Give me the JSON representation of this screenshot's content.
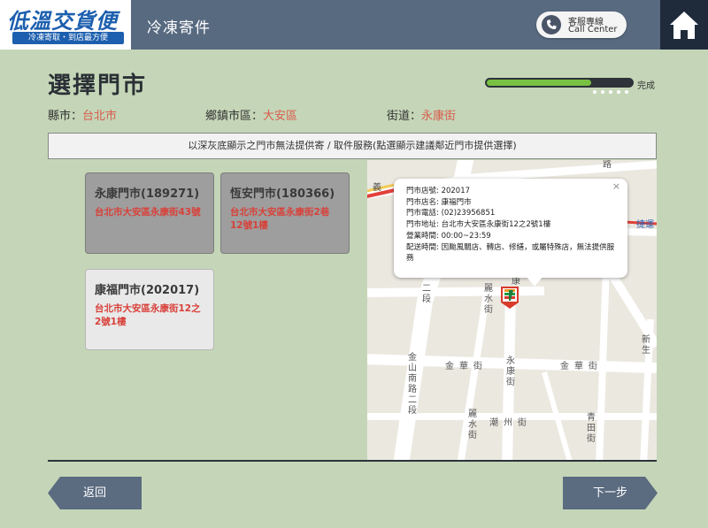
{
  "header": {
    "logo_text": "低溫交貨便",
    "logo_sub": "冷凍寄取・到店最方便",
    "title": "冷凍寄件",
    "call_center_line1": "客服專線",
    "call_center_line2": "Call Center",
    "phone_icon": "phone-icon",
    "home_icon": "home-icon"
  },
  "page": {
    "title": "選擇門市",
    "progress_label": "完成",
    "progress_fraction": 0.72
  },
  "filters": {
    "city_label": "縣市：",
    "city_value": "台北市",
    "district_label": "鄉鎮市區：",
    "district_value": "大安區",
    "street_label": "街道：",
    "street_value": "永康街"
  },
  "notice": "以深灰底顯示之門市無法提供寄 / 取件服務(點選顯示建議鄰近門市提供選擇)",
  "stores": [
    {
      "name": "永康門市(189271)",
      "address": "台北市大安區永康街43號",
      "available": false
    },
    {
      "name": "恆安門市(180366)",
      "address": "台北市大安區永康街2巷12號1樓",
      "available": false
    },
    {
      "name": "康福門市(202017)",
      "address": "台北市大安區永康街12之2號1樓",
      "available": true
    }
  ],
  "map": {
    "labels": {
      "lu": "路",
      "jie": "捷運",
      "yi": "義",
      "er_duan": "二段",
      "li_shui_jie_top": "麗水街",
      "kang_top": "康",
      "yong_kang_jie": "永康街",
      "jin_shan_nan_lu": "金山南路二段",
      "jin_hua_jie_left": "金華街",
      "jin_hua_jie_right": "金華街",
      "li_shui_jie_bottom": "麗水街",
      "chao_zhou_jie": "潮州街",
      "xin_sheng": "新生",
      "qing_tian_jie": "青田街"
    },
    "popup": {
      "store_id": "門市店號: 202017",
      "store_name": "門市店名: 康福門市",
      "phone": "門市電話: (02)23956851",
      "address": "門市地址: 台北市大安區永康街12之2號1樓",
      "hours": "營業時間: 00:00~23:59",
      "delivery": "配送時間: 因颱風關店、轉店、修繕，或屬特殊店，無法提供服務",
      "close": "×"
    },
    "marker_icon": "seven-eleven-marker-icon"
  },
  "footer": {
    "back_label": "返回",
    "next_label": "下一步"
  },
  "colors": {
    "background": "#c4d6b7",
    "header": "#586a80",
    "home_button": "#1f2b3b",
    "accent_red": "#d85c4e",
    "progress_green": "#79c143",
    "nav_button": "#5b6b80"
  }
}
